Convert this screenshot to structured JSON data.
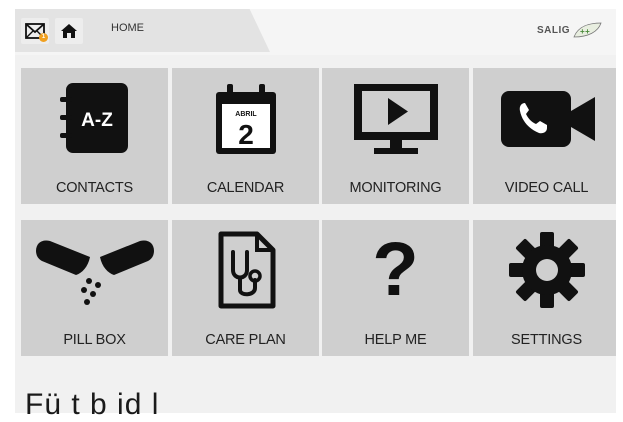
{
  "header": {
    "breadcrumb": "HOME",
    "brand": "SALIG",
    "brand_mark": "++",
    "mail_badge": "1",
    "icons": [
      "mail-icon",
      "home-icon"
    ]
  },
  "tiles": [
    {
      "label": "CONTACTS",
      "icon": "contacts-book-icon",
      "icon_text": "A-Z"
    },
    {
      "label": "CALENDAR",
      "icon": "calendar-icon",
      "month": "ABRIL",
      "day": "2"
    },
    {
      "label": "MONITORING",
      "icon": "monitor-play-icon"
    },
    {
      "label": "VIDEO CALL",
      "icon": "video-call-icon"
    },
    {
      "label": "PILL BOX",
      "icon": "pill-icon"
    },
    {
      "label": "CARE PLAN",
      "icon": "care-plan-stethoscope-icon"
    },
    {
      "label": "HELP ME",
      "icon": "question-mark-icon",
      "icon_text": "?"
    },
    {
      "label": "SETTINGS",
      "icon": "gear-icon"
    }
  ],
  "footer": {
    "text": "Fü t    b     id     l"
  },
  "colors": {
    "tile": "#cfcfcf",
    "background": "#f1f1f1",
    "icon": "#111111",
    "badge": "#f0a020"
  }
}
